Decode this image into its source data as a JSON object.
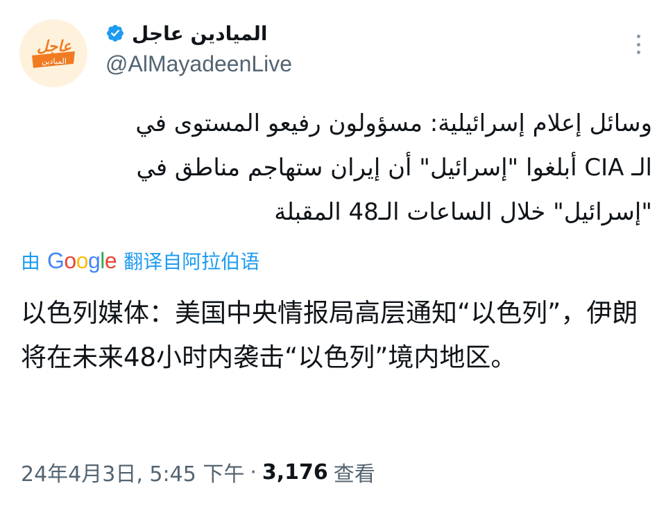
{
  "author": {
    "display_name": "الميادين عاجل",
    "handle": "@AlMayadeenLive",
    "avatar": {
      "badge_text": "عاجل",
      "sub_text": "الميادين",
      "colors": {
        "background": "#fff2dd",
        "accent": "#f07b22",
        "text": "#ffffff"
      }
    },
    "verified_icon": "verified-badge-icon"
  },
  "menu": {
    "icon": "more-vertical-icon"
  },
  "tweet": {
    "lines": [
      "وسائل إعلام إسرائيلية: مسؤولون رفيعو المستوى في",
      "الـ CIA أبلغوا \"إسرائيل\" أن إيران ستهاجم مناطق في",
      "\"إسرائيل\" خلال الساعات الـ48 المقبلة"
    ]
  },
  "translation": {
    "prefix": "由",
    "provider": "Google",
    "suffix": "翻译自阿拉伯语",
    "text": "以色列媒体：美国中央情报局高层通知“以色列”，伊朗将在未来48小时内袭击“以色列”境内地区。"
  },
  "meta": {
    "timestamp": "24年4月3日, 5:45 下午",
    "separator": "·",
    "views_count": "3,176",
    "views_label": "查看"
  },
  "colors": {
    "link": "#1d9bf0",
    "secondary_text": "#536471",
    "primary_text": "#0f1419",
    "verified": "#1d9bf0",
    "google_blue": "#4285F4",
    "google_red": "#EA4335",
    "google_yellow": "#FBBC05",
    "google_green": "#34A853"
  }
}
